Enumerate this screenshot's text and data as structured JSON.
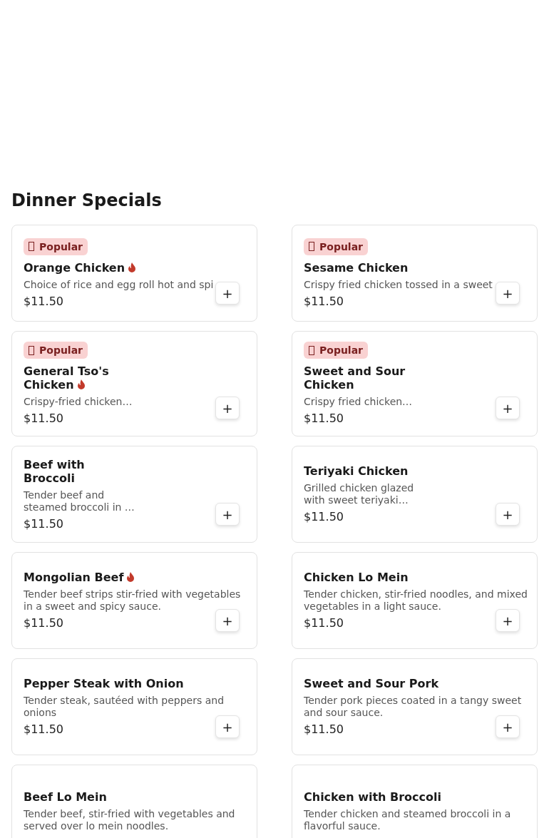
{
  "section": {
    "title": "Dinner Specials"
  },
  "items": [
    {
      "kind": "full",
      "badge": {
        "label": "Popular"
      },
      "name": "Orange Chicken",
      "spicy": true,
      "description": "Choice of rice and egg roll hot and spi",
      "price": "$11.50",
      "button": "+"
    },
    {
      "kind": "full",
      "badge": {
        "label": "Popular"
      },
      "name": "Sesame Chicken",
      "spicy": false,
      "description": "Crispy fried chicken tossed in a sweet",
      "price": "$11.50",
      "button": "+"
    },
    {
      "kind": "compact",
      "badge": {
        "label": "Popular"
      },
      "name": "General Tso's Chicken",
      "spicy": true,
      "description": "Crispy-fried chicken…",
      "price": "$11.50",
      "button": "+"
    },
    {
      "kind": "compact",
      "badge": {
        "label": "Popular"
      },
      "name": "Sweet and Sour Chicken",
      "spicy": false,
      "description": "Crispy fried chicken…",
      "price": "$11.50",
      "button": "+"
    },
    {
      "kind": "compact",
      "name": "Beef with Broccoli",
      "spicy": false,
      "description": "Tender beef and steamed broccoli in …",
      "price": "$11.50",
      "button": "+"
    },
    {
      "kind": "compact",
      "name": "Teriyaki Chicken",
      "spicy": false,
      "description": "Grilled chicken glazed with sweet teriyaki…",
      "price": "$11.50",
      "button": "+"
    },
    {
      "kind": "full",
      "name": "Mongolian Beef",
      "spicy": true,
      "description": "Tender beef strips stir-fried with vegetables in a sweet and spicy sauce.",
      "price": "$11.50",
      "button": "+"
    },
    {
      "kind": "full",
      "name": "Chicken Lo Mein",
      "spicy": false,
      "description": "Tender chicken, stir-fried noodles, and mixed vegetables in a light sauce.",
      "price": "$11.50",
      "button": "+"
    },
    {
      "kind": "full",
      "name": "Pepper Steak with Onion",
      "spicy": false,
      "description": "Tender steak, sautéed with peppers and onions",
      "price": "$11.50",
      "button": "+"
    },
    {
      "kind": "full",
      "name": "Sweet and Sour Pork",
      "spicy": false,
      "description": "Tender pork pieces coated in a tangy sweet and sour sauce.",
      "price": "$11.50",
      "button": "+"
    },
    {
      "kind": "full",
      "name": "Beef Lo Mein",
      "spicy": false,
      "description": "Tender beef, stir-fried with vegetables and served over lo mein noodles."
    },
    {
      "kind": "full",
      "name": "Chicken with Broccoli",
      "spicy": false,
      "description": "Tender chicken and steamed broccoli in a flavorful sauce."
    }
  ]
}
